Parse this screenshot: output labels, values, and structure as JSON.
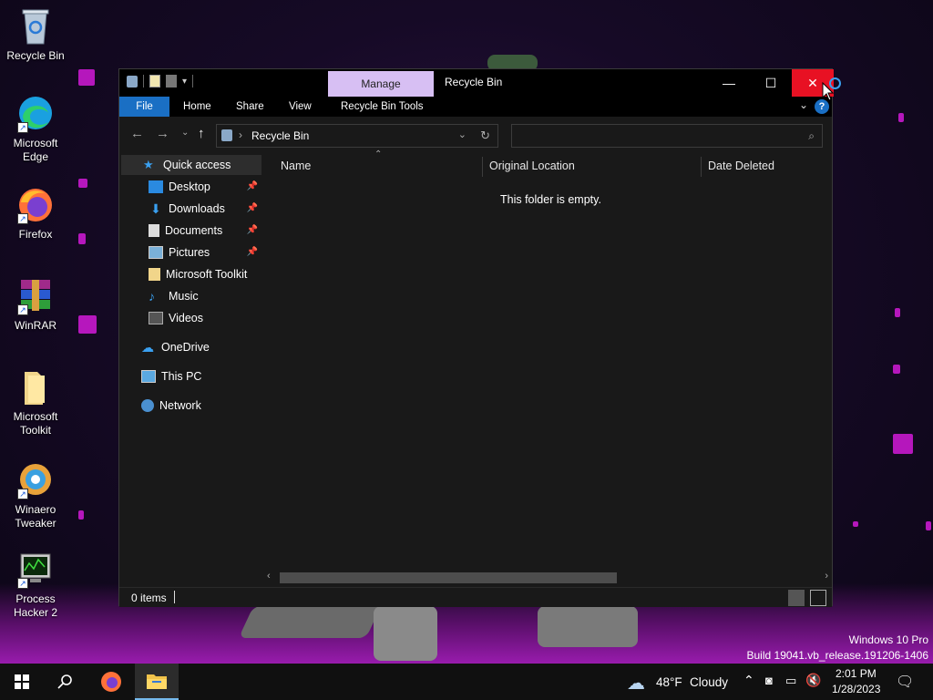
{
  "desktop": {
    "icons": [
      {
        "label_line1": "Recycle Bin",
        "label_line2": ""
      },
      {
        "label_line1": "Microsoft",
        "label_line2": "Edge"
      },
      {
        "label_line1": "Firefox",
        "label_line2": ""
      },
      {
        "label_line1": "WinRAR",
        "label_line2": ""
      },
      {
        "label_line1": "Microsoft",
        "label_line2": "Toolkit"
      },
      {
        "label_line1": "Winaero",
        "label_line2": "Tweaker"
      },
      {
        "label_line1": "Process",
        "label_line2": "Hacker 2"
      }
    ],
    "watermark_line1": "Windows 10 Pro",
    "watermark_line2": "Build 19041.vb_release.191206-1406"
  },
  "window": {
    "title": "Recycle Bin",
    "manage_tab": "Manage",
    "controls": {
      "minimize": "—",
      "maximize": "☐",
      "close": "✕"
    },
    "ribbon_tabs": [
      "File",
      "Home",
      "Share",
      "View",
      "Recycle Bin Tools"
    ],
    "help": "?",
    "address": {
      "breadcrumb": "Recycle Bin"
    },
    "search": {
      "placeholder": "",
      "value": ""
    },
    "nav": {
      "quick_access": "Quick access",
      "pinned": [
        "Desktop",
        "Downloads",
        "Documents",
        "Pictures"
      ],
      "others": [
        "Microsoft Toolkit",
        "Music",
        "Videos"
      ],
      "onedrive": "OneDrive",
      "this_pc": "This PC",
      "network": "Network"
    },
    "columns": [
      "Name",
      "Original Location",
      "Date Deleted"
    ],
    "empty_message": "This folder is empty.",
    "status": {
      "item_count": "0 items"
    }
  },
  "taskbar": {
    "weather": {
      "temp": "48°F",
      "condition": "Cloudy"
    },
    "clock": {
      "time": "2:01 PM",
      "date": "1/28/2023"
    }
  },
  "colors": {
    "accent": "#1a6fc4",
    "manage_tab": "#d7bff3",
    "close_button": "#e81123",
    "window_bg": "#191919",
    "desktop_glow": "#d21ad8"
  }
}
